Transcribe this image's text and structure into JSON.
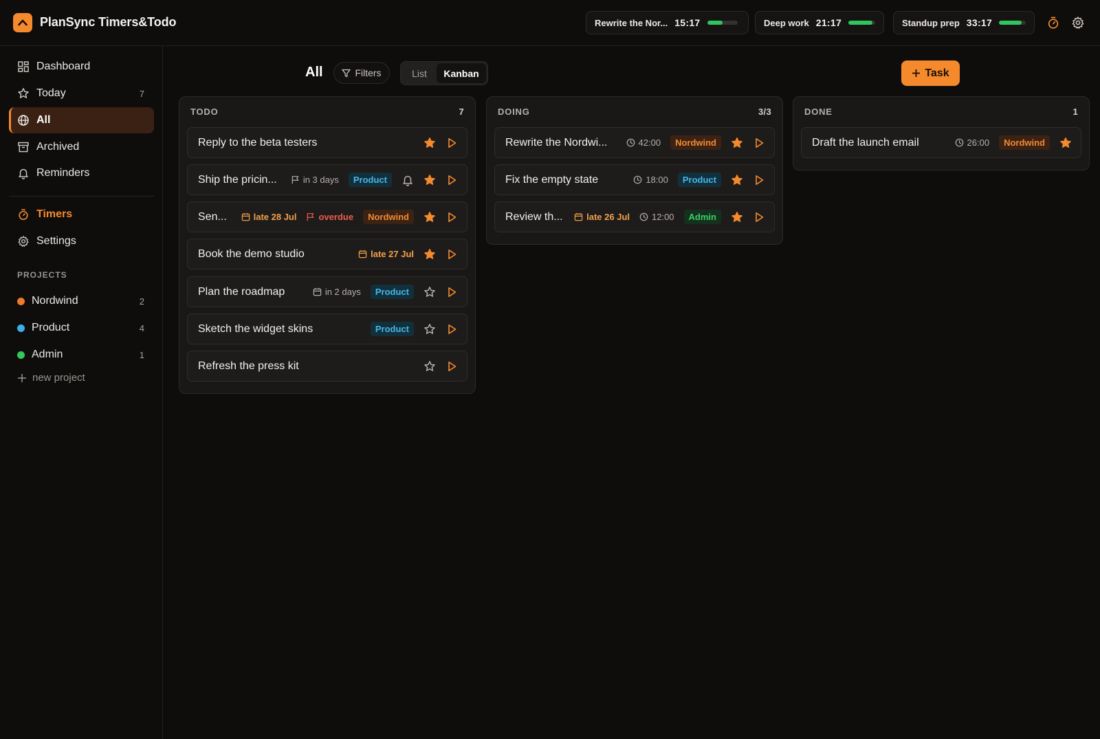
{
  "app": {
    "title": "PlanSync Timers&Todo",
    "logo_icon": "chevron-up-icon",
    "accent": "#f58a2c"
  },
  "timers": [
    {
      "label": "Rewrite the Nor...",
      "time": "15:17",
      "progress": 0.5
    },
    {
      "label": "Deep work",
      "time": "21:17",
      "progress": 0.9
    },
    {
      "label": "Standup prep",
      "time": "33:17",
      "progress": 0.85
    }
  ],
  "sidebar": {
    "nav": [
      {
        "label": "Dashboard",
        "icon": "dashboard-icon",
        "count": ""
      },
      {
        "label": "Today",
        "icon": "star-icon",
        "count": "7"
      },
      {
        "label": "All",
        "icon": "globe-icon",
        "count": ""
      },
      {
        "label": "Archived",
        "icon": "archive-icon",
        "count": ""
      },
      {
        "label": "Reminders",
        "icon": "bell-icon",
        "count": ""
      }
    ],
    "nav2": [
      {
        "label": "Timers",
        "icon": "timer-icon"
      },
      {
        "label": "Settings",
        "icon": "gear-icon"
      }
    ],
    "projects_label": "PROJECTS",
    "projects": [
      {
        "name": "Nordwind",
        "count": "2",
        "color": "#f07a2b"
      },
      {
        "name": "Product",
        "count": "4",
        "color": "#3ab0ea"
      },
      {
        "name": "Admin",
        "count": "1",
        "color": "#34c759"
      }
    ],
    "new_project": "new project"
  },
  "toolbar": {
    "title": "All",
    "filters": "Filters",
    "list": "List",
    "kanban": "Kanban",
    "add_task": "Task"
  },
  "columns": [
    {
      "name": "TODO",
      "count": "7",
      "cards": [
        {
          "title": "Reply to the beta testers",
          "starred": true
        },
        {
          "title": "Ship the pricin...",
          "due": "in 3 days",
          "tag": "Product",
          "bell": true,
          "starred": true
        },
        {
          "title": "Sen...",
          "late": "late 28 Jul",
          "overdue": "overdue",
          "tag": "Nordwind",
          "starred": true
        },
        {
          "title": "Book the demo studio",
          "late": "late 27 Jul",
          "starred": true
        },
        {
          "title": "Plan the roadmap",
          "date": "in 2 days",
          "tag": "Product",
          "starred": false
        },
        {
          "title": "Sketch the widget skins",
          "tag": "Product",
          "starred": false
        },
        {
          "title": "Refresh the press kit",
          "starred": false
        }
      ]
    },
    {
      "name": "DOING",
      "count": "3/3",
      "cards": [
        {
          "title": "Rewrite the Nordwi...",
          "duration": "42:00",
          "tag": "Nordwind",
          "starred": true
        },
        {
          "title": "Fix the empty state",
          "duration": "18:00",
          "tag": "Product",
          "starred": true
        },
        {
          "title": "Review th...",
          "late": "late 26 Jul",
          "duration": "12:00",
          "tag": "Admin",
          "starred": true
        }
      ]
    },
    {
      "name": "DONE",
      "count": "1",
      "cards": [
        {
          "title": "Draft the launch email",
          "duration": "26:00",
          "tag": "Nordwind",
          "starred": true,
          "no_play": true
        }
      ]
    }
  ]
}
